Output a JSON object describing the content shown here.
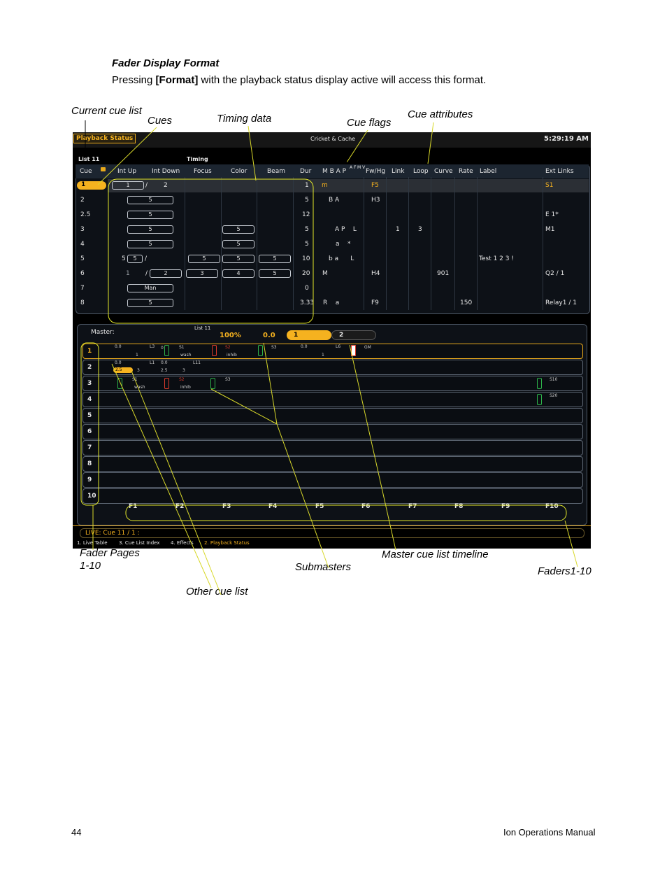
{
  "heading": "Fader Display Format",
  "intro": {
    "pre": "Pressing ",
    "key": "[Format]",
    "post": " with the playback status display active will access this format."
  },
  "callouts": {
    "current_cue_list": "Current cue list",
    "cues": "Cues",
    "timing_data": "Timing data",
    "cue_flags": "Cue flags",
    "cue_attributes": "Cue attributes",
    "fader_pages_1": "Fader Pages",
    "fader_pages_2": "1-10",
    "submasters": "Submasters",
    "master_timeline": "Master cue list timeline",
    "faders": "Faders1-10",
    "other_cue_list": "Other cue list"
  },
  "console": {
    "tab": "Playback Status",
    "title": "Cricket & Cache",
    "clock": "5:29:19 AM",
    "list_label": "List 11",
    "timing_label": "Timing",
    "columns": [
      "Cue",
      "Int Up",
      "Int Down",
      "Focus",
      "Color",
      "Beam",
      "Dur",
      "M B A P",
      "A F",
      "M V",
      "Fw/Hg",
      "Link",
      "Loop",
      "Curve",
      "Rate",
      "Label",
      "Ext Links"
    ],
    "rows": [
      {
        "cue": "1",
        "up": "1",
        "down": "2",
        "dur": "1",
        "flags": "m",
        "fw": "F5",
        "ext": "S1"
      },
      {
        "cue": "2",
        "up": "5",
        "dur": "5",
        "flags": "B A",
        "fw": "H3"
      },
      {
        "cue": "2.5",
        "up": "5",
        "dur": "12",
        "ext": "E  1*"
      },
      {
        "cue": "3",
        "up": "5",
        "color": "5",
        "dur": "5",
        "flags": "A P    L",
        "link": "1",
        "loop": "3",
        "ext": "M1"
      },
      {
        "cue": "4",
        "up": "5",
        "color": "5",
        "dur": "5",
        "flags": "a    *"
      },
      {
        "cue": "5",
        "upa": "5",
        "up": "5",
        "down": "5",
        "color": "5",
        "beam": "5",
        "dur": "10",
        "flags": "b a      L",
        "label": "Test 1 2 3 !"
      },
      {
        "cue": "6",
        "upa": "1",
        "down": "2",
        "focus": "3",
        "color": "4",
        "beam": "5",
        "dur": "20",
        "flags": "M",
        "fw": "H4",
        "curve": "901",
        "ext": "Q2 / 1"
      },
      {
        "cue": "7",
        "up": "Man",
        "dur": "0"
      },
      {
        "cue": "8",
        "up": "5",
        "dur": "3.33",
        "flags": "R    a",
        "fw": "F9",
        "rate": "150",
        "ext": "Relay1 / 1"
      }
    ],
    "master_label": "Master:",
    "master_list": "List 11",
    "master_pct": "100%",
    "master_time": "0.0",
    "master_cue_a": "1",
    "master_cue_b": "2",
    "fader_rows": [
      "1",
      "2",
      "3",
      "4",
      "5",
      "6",
      "7",
      "8",
      "9",
      "10"
    ],
    "fader_details": {
      "r1": [
        "0.0",
        "L3",
        "0",
        "S1",
        "wash",
        "S2",
        "inhib",
        "S3",
        "0.0",
        "L6",
        "1",
        "GM",
        "1",
        "1"
      ],
      "r2": [
        "0.0",
        "L1",
        "0.0",
        "L11",
        "2.5",
        "3",
        "2.5",
        "3"
      ],
      "r3": [
        "S1",
        "wash",
        "S2",
        "inhib",
        "S3",
        "S10"
      ],
      "r4": [
        "S20"
      ]
    },
    "fkeys": [
      "F1",
      "F2",
      "F3",
      "F4",
      "F5",
      "F6",
      "F7",
      "F8",
      "F9",
      "F10"
    ],
    "live": "LIVE: Cue  11 / 1 :",
    "bottom_tabs": [
      "1. Live Table",
      "3. Cue List Index",
      "4. Effects",
      "2. Playback Status"
    ]
  },
  "footer": {
    "page": "44",
    "manual": "Ion Operations Manual"
  }
}
